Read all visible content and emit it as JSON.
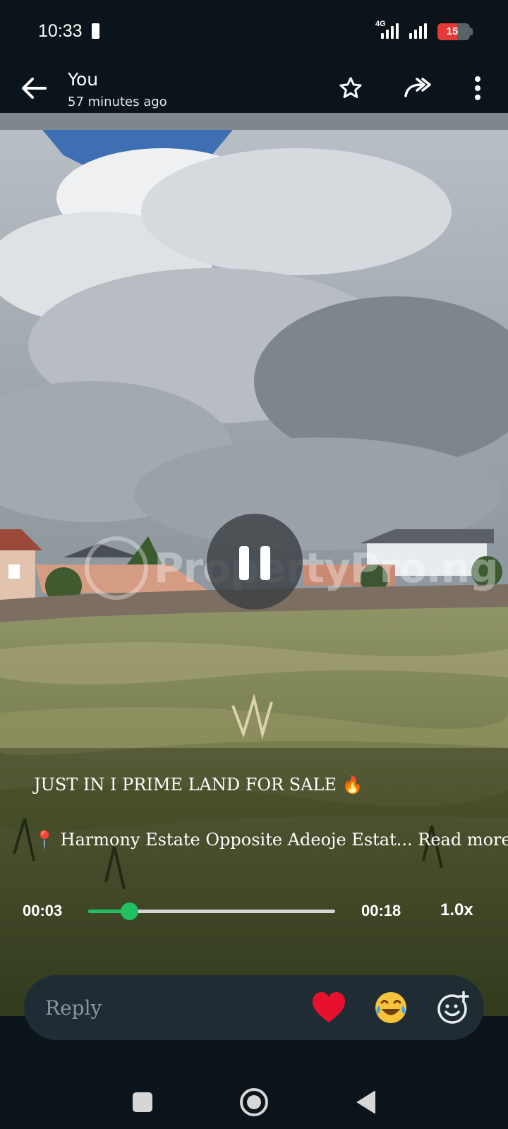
{
  "status_bar": {
    "time": "10:33",
    "network": "4G",
    "battery_level": "15",
    "battery_fraction": 0.15,
    "battery_color": "#e53935"
  },
  "header": {
    "poster_name": "You",
    "posted_time": "57 minutes ago",
    "icons": [
      "back-arrow-icon",
      "star-icon",
      "forward-icon",
      "more-vert-icon"
    ]
  },
  "media": {
    "watermark": "PropertyPro.ng",
    "playback_state": "playing"
  },
  "caption": {
    "title": "JUST IN I PRIME LAND FOR SALE",
    "title_emoji": "🔥",
    "location_emoji": "📍",
    "location_text": "Harmony Estate Opposite Adeoje Estat...",
    "read_more": "Read more"
  },
  "playback": {
    "current_time": "00:03",
    "total_time": "00:18",
    "progress": 0.165,
    "speed": "1.0x",
    "accent_color": "#21c063"
  },
  "reply": {
    "placeholder": "Reply",
    "reactions": [
      "❤️",
      "😂"
    ],
    "icons": [
      "heart-icon",
      "tears-of-joy-icon",
      "add-reaction-icon"
    ]
  },
  "nav_bar": {
    "icons": [
      "recents-square-icon",
      "home-circle-icon",
      "back-triangle-icon"
    ]
  }
}
